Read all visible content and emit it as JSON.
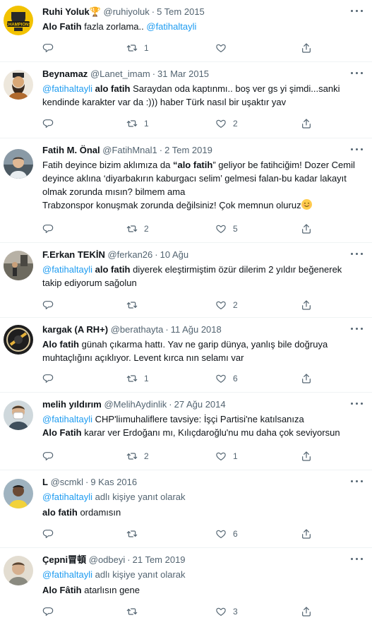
{
  "icons": {
    "reply": "reply-icon",
    "retweet": "retweet-icon",
    "like": "heart-icon",
    "share": "share-icon",
    "more": "more-icon"
  },
  "colors": {
    "link": "#1d9bf0",
    "secondary": "#536471",
    "border": "#eff3f4"
  },
  "tweets": [
    {
      "name": "Ruhi Yoluk🏆",
      "handle": "@ruhiyoluk",
      "date": "5 Tem 2015",
      "body": [
        [
          "b",
          "Alo Fatih"
        ],
        [
          "t",
          " fazla zorlama.. "
        ],
        [
          "m",
          "@fatihaltayli"
        ]
      ],
      "replies": "",
      "retweets": "1",
      "likes": ""
    },
    {
      "name": "Beynamaz",
      "handle": "@Lanet_imam",
      "date": "31 Mar 2015",
      "body": [
        [
          "m",
          "@fatihaltayli"
        ],
        [
          "t",
          " "
        ],
        [
          "b",
          "alo fatih"
        ],
        [
          "t",
          " Saraydan oda kaptınmı.. boş ver gs yi şimdi...sanki kendinde karakter var da :))) haber Türk nasıl bir uşaktır yav"
        ]
      ],
      "replies": "",
      "retweets": "1",
      "likes": "2"
    },
    {
      "name": "Fatih M. Önal",
      "handle": "@FatihMnal1",
      "date": "2 Tem 2019",
      "body": [
        [
          "t",
          "Fatih deyince bizim aklımıza da "
        ],
        [
          "b",
          "“alo fatih"
        ],
        [
          "t",
          "” geliyor be fatihciğim! Dozer Cemil deyince aklına ‘diyarbakırın kaburgacı selim’ gelmesi falan-bu kadar lakayıt olmak zorunda mısın? bilmem ama"
        ],
        [
          "br",
          ""
        ],
        [
          "t",
          "Trabzonspor konuşmak zorunda değilsiniz! Çok memnun oluruz"
        ],
        [
          "emoji",
          "smiling-face"
        ]
      ],
      "replies": "",
      "retweets": "2",
      "likes": "5"
    },
    {
      "name": "F.Erkan TEKİN",
      "handle": "@ferkan26",
      "date": "10 Ağu",
      "body": [
        [
          "m",
          "@fatihaltayli"
        ],
        [
          "t",
          "  "
        ],
        [
          "b",
          "alo fatih"
        ],
        [
          "t",
          " diyerek eleştirmiştim özür dilerim 2 yıldır beğenerek takip ediyorum sağolun"
        ]
      ],
      "replies": "",
      "retweets": "",
      "likes": "2"
    },
    {
      "name": "kargak (A RH+)",
      "handle": "@berathayta",
      "date": "11 Ağu 2018",
      "body": [
        [
          "b",
          "Alo fatih"
        ],
        [
          "t",
          " günah çıkarma hattı. Yav  ne garip dünya, yanlış bile doğruya muhtaçlığını açıklıyor. Levent kırca nın selamı var"
        ]
      ],
      "replies": "",
      "retweets": "1",
      "likes": "6"
    },
    {
      "name": "melih yıldırım",
      "handle": "@MelihAydinlik",
      "date": "27 Ağu 2014",
      "body": [
        [
          "m",
          "@fatihaltayli"
        ],
        [
          "t",
          " CHP'liımuhaliflere tavsiye: İşçi Partisi'ne katılsanıza "
        ],
        [
          "br",
          ""
        ],
        [
          "b",
          "Alo Fatih"
        ],
        [
          "t",
          " karar ver Erdoğanı mı, Kılıçdaroğlu'nu mu daha çok seviyorsun"
        ]
      ],
      "replies": "",
      "retweets": "2",
      "likes": "1"
    },
    {
      "name": "L",
      "handle": "@scmkl",
      "date": "9 Kas 2016",
      "reply_to": {
        "mention": "@fatihaltayli",
        "suffix": " adlı kişiye yanıt olarak"
      },
      "body": [
        [
          "b",
          "alo fatih"
        ],
        [
          "t",
          " ordamısın"
        ]
      ],
      "replies": "",
      "retweets": "",
      "likes": "6"
    },
    {
      "name": "Çepni冒頓",
      "handle": "@odbeyi",
      "date": "21 Tem 2019",
      "reply_to": {
        "mention": "@fatihaltayli",
        "suffix": " adlı kişiye yanıt olarak"
      },
      "body": [
        [
          "b",
          "Alo Fâtih"
        ],
        [
          "t",
          " atarlısın gene"
        ]
      ],
      "replies": "",
      "retweets": "",
      "likes": "3"
    }
  ]
}
